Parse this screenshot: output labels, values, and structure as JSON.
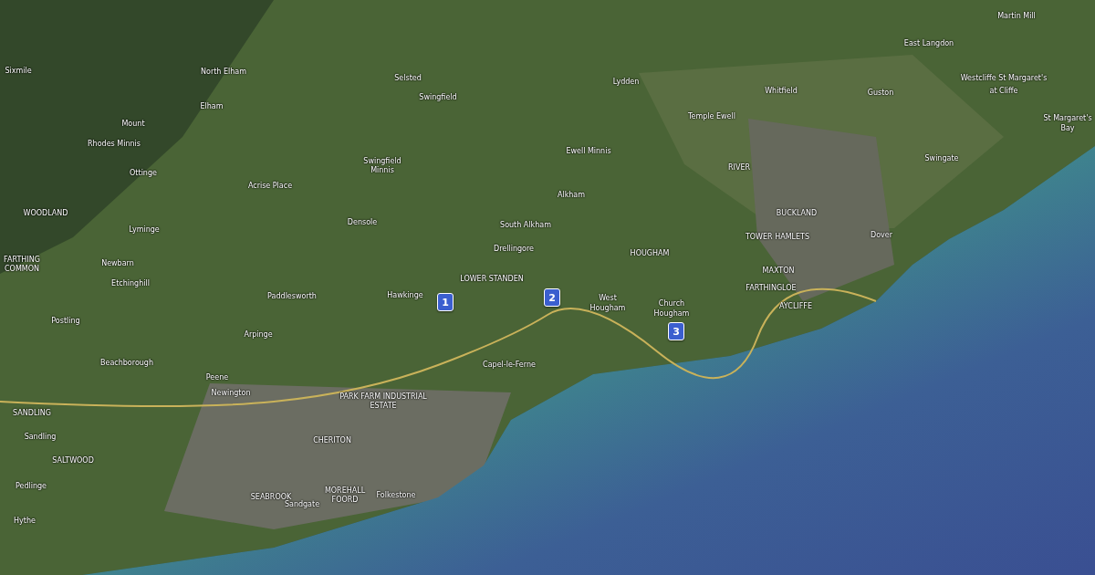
{
  "map_labels": [
    {
      "text": "Sixmile"
    },
    {
      "text": "North Elham"
    },
    {
      "text": "Elham"
    },
    {
      "text": "Mount"
    },
    {
      "text": "Rhodes Minnis"
    },
    {
      "text": "Ottinge"
    },
    {
      "text": "Acrise Place"
    },
    {
      "text": "WOODLAND"
    },
    {
      "text": "Lyminge"
    },
    {
      "text": "FARTHING"
    },
    {
      "text": "COMMON"
    },
    {
      "text": "Newbarn"
    },
    {
      "text": "Etchinghill"
    },
    {
      "text": "Postling"
    },
    {
      "text": "Paddlesworth"
    },
    {
      "text": "Arpinge"
    },
    {
      "text": "Beachborough"
    },
    {
      "text": "Peene"
    },
    {
      "text": "Newington"
    },
    {
      "text": "SANDLING"
    },
    {
      "text": "Sandling"
    },
    {
      "text": "SALTWOOD"
    },
    {
      "text": "Pedlinge"
    },
    {
      "text": "Hythe"
    },
    {
      "text": "SEABROOK"
    },
    {
      "text": "Sandgate"
    },
    {
      "text": "MOREHALL"
    },
    {
      "text": "FOORD"
    },
    {
      "text": "Folkestone"
    },
    {
      "text": "CHERITON"
    },
    {
      "text": "PARK FARM INDUSTRIAL"
    },
    {
      "text": "ESTATE"
    },
    {
      "text": "Selsted"
    },
    {
      "text": "Swingfield"
    },
    {
      "text": "Swingfield"
    },
    {
      "text": "Minnis"
    },
    {
      "text": "Densole"
    },
    {
      "text": "Hawkinge"
    },
    {
      "text": "Drellingore"
    },
    {
      "text": "LOWER STANDEN"
    },
    {
      "text": "South Alkham"
    },
    {
      "text": "Alkham"
    },
    {
      "text": "Ewell Minnis"
    },
    {
      "text": "Lydden"
    },
    {
      "text": "Temple Ewell"
    },
    {
      "text": "Whitfield"
    },
    {
      "text": "East Langdon"
    },
    {
      "text": "Martin Mill"
    },
    {
      "text": "Guston"
    },
    {
      "text": "Westcliffe St Margaret's"
    },
    {
      "text": "at Cliffe"
    },
    {
      "text": "St Margaret's"
    },
    {
      "text": "Bay"
    },
    {
      "text": "Swingate"
    },
    {
      "text": "RIVER"
    },
    {
      "text": "BUCKLAND"
    },
    {
      "text": "TOWER HAMLETS"
    },
    {
      "text": "Dover"
    },
    {
      "text": "MAXTON"
    },
    {
      "text": "FARTHINGLOE"
    },
    {
      "text": "HOUGHAM"
    },
    {
      "text": "West"
    },
    {
      "text": "Hougham"
    },
    {
      "text": "Church"
    },
    {
      "text": "Hougham"
    },
    {
      "text": "AYCLIFFE"
    },
    {
      "text": "Capel-le-Ferne"
    }
  ],
  "markers": [
    {
      "label": "1"
    },
    {
      "label": "2"
    },
    {
      "label": "3"
    }
  ]
}
